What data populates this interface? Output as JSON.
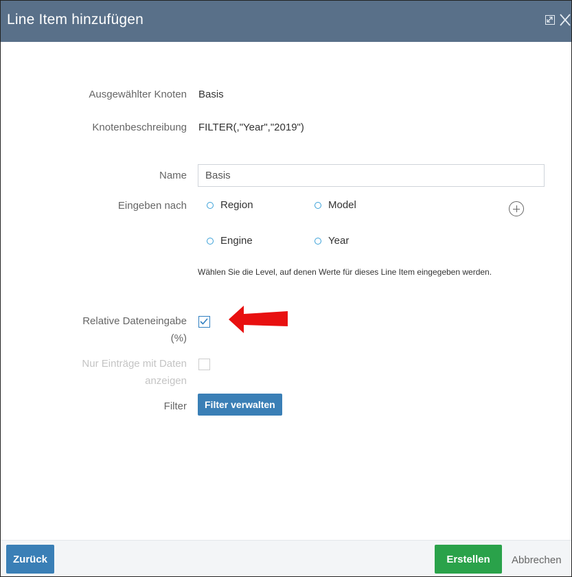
{
  "dialog": {
    "title": "Line Item hinzufügen"
  },
  "fields": {
    "selected_node_label": "Ausgewählter Knoten",
    "selected_node_value": "Basis",
    "node_description_label": "Knotenbeschreibung",
    "node_description_value": "FILTER(,\"Year\",\"2019\")",
    "name_label": "Name",
    "name_value": "Basis",
    "enter_by_label": "Eingeben nach",
    "levels": [
      {
        "label": "Region",
        "selected": false
      },
      {
        "label": "Model",
        "selected": false
      },
      {
        "label": "Engine",
        "selected": false
      },
      {
        "label": "Year",
        "selected": false
      }
    ],
    "levels_hint": "Wählen Sie die Level, auf denen Werte für dieses Line Item eingegeben werden.",
    "relative_input_label_line1": "Relative Dateneingabe",
    "relative_input_label_line2": "(%)",
    "relative_input_checked": true,
    "only_with_data_label_line1": "Nur Einträge mit Daten",
    "only_with_data_label_line2": "anzeigen",
    "only_with_data_checked": false,
    "filter_label": "Filter",
    "filter_button": "Filter verwalten"
  },
  "footer": {
    "back_button": "Zurück",
    "create_button": "Erstellen",
    "cancel_link": "Abbrechen"
  },
  "colors": {
    "titlebar": "#597089",
    "primary_button": "#3a7fb6",
    "create_button": "#2aa24a",
    "annotation_arrow": "#e81010"
  },
  "icons": [
    "expand-icon",
    "close-icon",
    "add-level-icon",
    "annotation-arrow"
  ]
}
